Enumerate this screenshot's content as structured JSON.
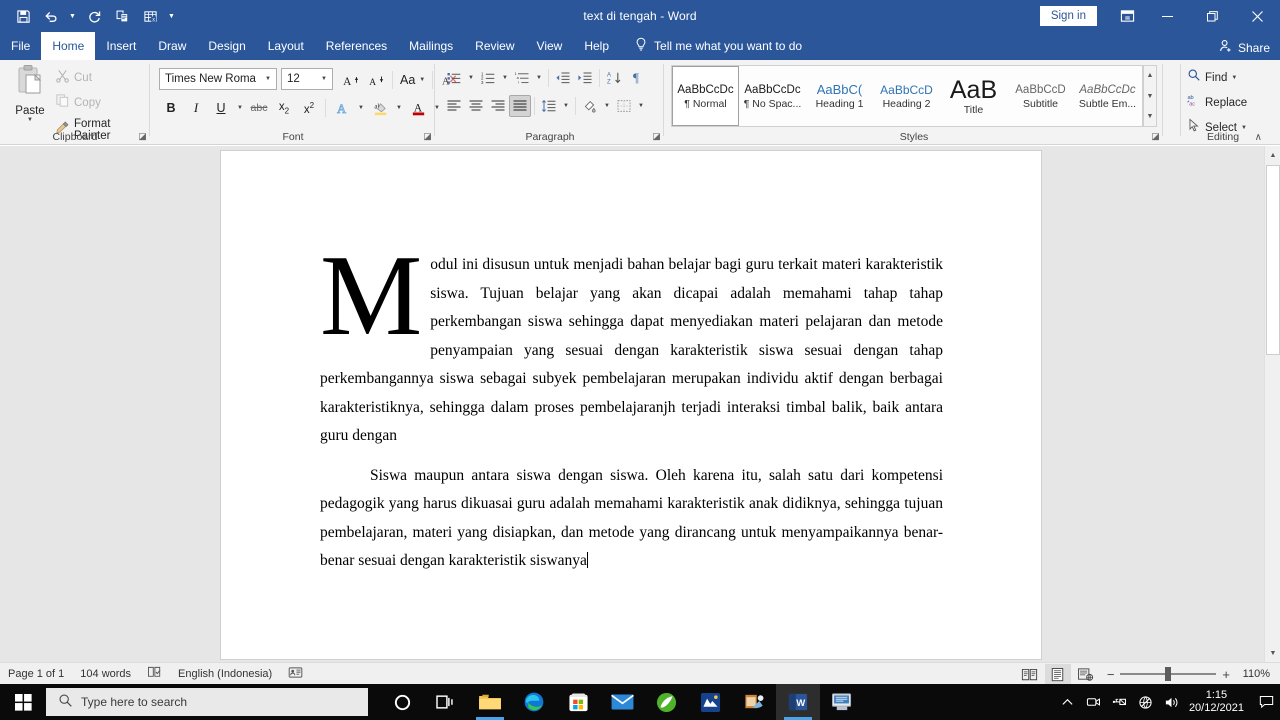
{
  "titlebar": {
    "document_title": "text di tengah  -  Word",
    "sign_in_label": "Sign in",
    "quick_access": [
      {
        "name": "save-icon",
        "label": "Save"
      },
      {
        "name": "undo-icon",
        "label": "Undo"
      },
      {
        "name": "redo-icon",
        "label": "Redo"
      },
      {
        "name": "copy-format-icon",
        "label": "Copy"
      },
      {
        "name": "excel-table-icon",
        "label": "Table"
      }
    ],
    "customize_qat_label": "Customize Quick Access Toolbar",
    "ribbon_display_label": "Ribbon Display Options",
    "minimize_label": "Minimize",
    "restore_label": "Restore Down",
    "close_label": "Close"
  },
  "tabs": [
    {
      "label": "File",
      "active": false
    },
    {
      "label": "Home",
      "active": true
    },
    {
      "label": "Insert",
      "active": false
    },
    {
      "label": "Draw",
      "active": false
    },
    {
      "label": "Design",
      "active": false
    },
    {
      "label": "Layout",
      "active": false
    },
    {
      "label": "References",
      "active": false
    },
    {
      "label": "Mailings",
      "active": false
    },
    {
      "label": "Review",
      "active": false
    },
    {
      "label": "View",
      "active": false
    },
    {
      "label": "Help",
      "active": false
    }
  ],
  "tell_me": "Tell me what you want to do",
  "share_label": "Share",
  "ribbon": {
    "clipboard": {
      "group_label": "Clipboard",
      "paste_label": "Paste",
      "cut_label": "Cut",
      "copy_label": "Copy",
      "format_painter_label": "Format Painter"
    },
    "font": {
      "group_label": "Font",
      "font_name": "Times New Roma",
      "font_size": "12",
      "grow_font_label": "Increase Font Size",
      "shrink_font_label": "Decrease Font Size",
      "change_case_label": "Aa",
      "clear_formatting_label": "Clear All Formatting",
      "bold_label": "B",
      "italic_label": "I",
      "underline_label": "U",
      "strikethrough_label": "abc",
      "subscript_label": "x",
      "superscript_label": "x",
      "text_effects_label": "A",
      "highlight_label": "ab",
      "font_color_label": "A"
    },
    "paragraph": {
      "group_label": "Paragraph",
      "bullets_label": "Bullets",
      "numbering_label": "Numbering",
      "multilevel_label": "Multilevel List",
      "decrease_indent_label": "Decrease Indent",
      "increase_indent_label": "Increase Indent",
      "sort_label": "Sort",
      "show_marks_label": "Show/Hide",
      "align_left_label": "Align Left",
      "align_center_label": "Center",
      "align_right_label": "Align Right",
      "justify_label": "Justify",
      "justify_selected": true,
      "line_spacing_label": "Line and Paragraph Spacing",
      "shading_label": "Shading",
      "borders_label": "Borders"
    },
    "styles": {
      "group_label": "Styles",
      "items": [
        {
          "preview": "AaBbCcDc",
          "name": "¶ Normal",
          "selected": true,
          "color": "#1a1a1a",
          "size": "11.5px",
          "italic": false
        },
        {
          "preview": "AaBbCcDc",
          "name": "¶ No Spac...",
          "selected": false,
          "color": "#1a1a1a",
          "size": "11.5px",
          "italic": false
        },
        {
          "preview": "AaBbC(",
          "name": "Heading 1",
          "selected": false,
          "color": "#2e74b5",
          "size": "13px",
          "italic": false
        },
        {
          "preview": "AaBbCcD",
          "name": "Heading 2",
          "selected": false,
          "color": "#2e74b5",
          "size": "12px",
          "italic": false
        },
        {
          "preview": "AaB",
          "name": "Title",
          "selected": false,
          "color": "#1a1a1a",
          "size": "24px",
          "italic": false
        },
        {
          "preview": "AaBbCcD",
          "name": "Subtitle",
          "selected": false,
          "color": "#595959",
          "size": "11.5px",
          "italic": false
        },
        {
          "preview": "AaBbCcDc",
          "name": "Subtle Em...",
          "selected": false,
          "color": "#595959",
          "size": "11.5px",
          "italic": true
        }
      ]
    },
    "editing": {
      "group_label": "Editing",
      "find_label": "Find",
      "replace_label": "Replace",
      "select_label": "Select"
    }
  },
  "document": {
    "dropcap": "M",
    "paragraph1": "odul ini disusun untuk menjadi bahan belajar bagi guru terkait materi karakteristik siswa. Tujuan belajar yang akan dicapai adalah memahami tahap tahap perkembangan siswa sehingga dapat menyediakan materi pelajaran dan metode penyampaian yang sesuai dengan karakteristik siswa sesuai dengan tahap perkembangannya siswa sebagai subyek pembelajaran merupakan individu aktif dengan berbagai karakteristiknya, sehingga dalam proses pembelajaranjh terjadi interaksi timbal balik, baik antara guru dengan",
    "paragraph2": "Siswa maupun antara siswa dengan siswa. Oleh karena itu, salah satu dari kompetensi pedagogik yang harus dikuasai guru adalah memahami karakteristik anak didiknya, sehingga tujuan pembelajaran, materi yang disiapkan, dan metode yang dirancang untuk menyampaikannya benar-benar sesuai dengan karakteristik siswanya"
  },
  "statusbar": {
    "page": "Page 1 of 1",
    "words": "104 words",
    "proofing_label": "Proofing errors",
    "language": "English (Indonesia)",
    "accessibility_label": "Accessibility Checker",
    "read_mode_label": "Read Mode",
    "print_layout_label": "Print Layout",
    "web_layout_label": "Web Layout",
    "zoom_out_label": "−",
    "zoom_in_label": "+",
    "zoom_level": "110%"
  },
  "taskbar": {
    "start_label": "Start",
    "search_placeholder": "Type here to search",
    "items": [
      {
        "name": "cortana-icon",
        "label": "Cortana"
      },
      {
        "name": "task-view-icon",
        "label": "Task View"
      },
      {
        "name": "file-explorer-icon",
        "label": "File Explorer"
      },
      {
        "name": "microsoft-edge-icon",
        "label": "Microsoft Edge"
      },
      {
        "name": "microsoft-store-icon",
        "label": "Microsoft Store"
      },
      {
        "name": "mail-icon",
        "label": "Mail"
      },
      {
        "name": "green-app-icon",
        "label": "Green App"
      },
      {
        "name": "blue-mountain-app-icon",
        "label": "App"
      },
      {
        "name": "media-app-icon",
        "label": "Media App"
      },
      {
        "name": "word-icon",
        "label": "Word"
      },
      {
        "name": "kiosk-app-icon",
        "label": "App"
      }
    ],
    "tray": {
      "show_hidden_label": "Show hidden icons",
      "camera_label": "Camera",
      "usb_label": "USB",
      "network_label": "Network",
      "volume_label": "Volume",
      "time": "1:15",
      "date": "20/12/2021",
      "action_center_label": "Action Center"
    }
  },
  "colors": {
    "word_blue": "#2b579a",
    "ribbon_bg": "#f3f3f3",
    "doc_bg": "#e6e6e6",
    "accent_heading": "#2e74b5",
    "taskbar": "#0a0a0a"
  }
}
